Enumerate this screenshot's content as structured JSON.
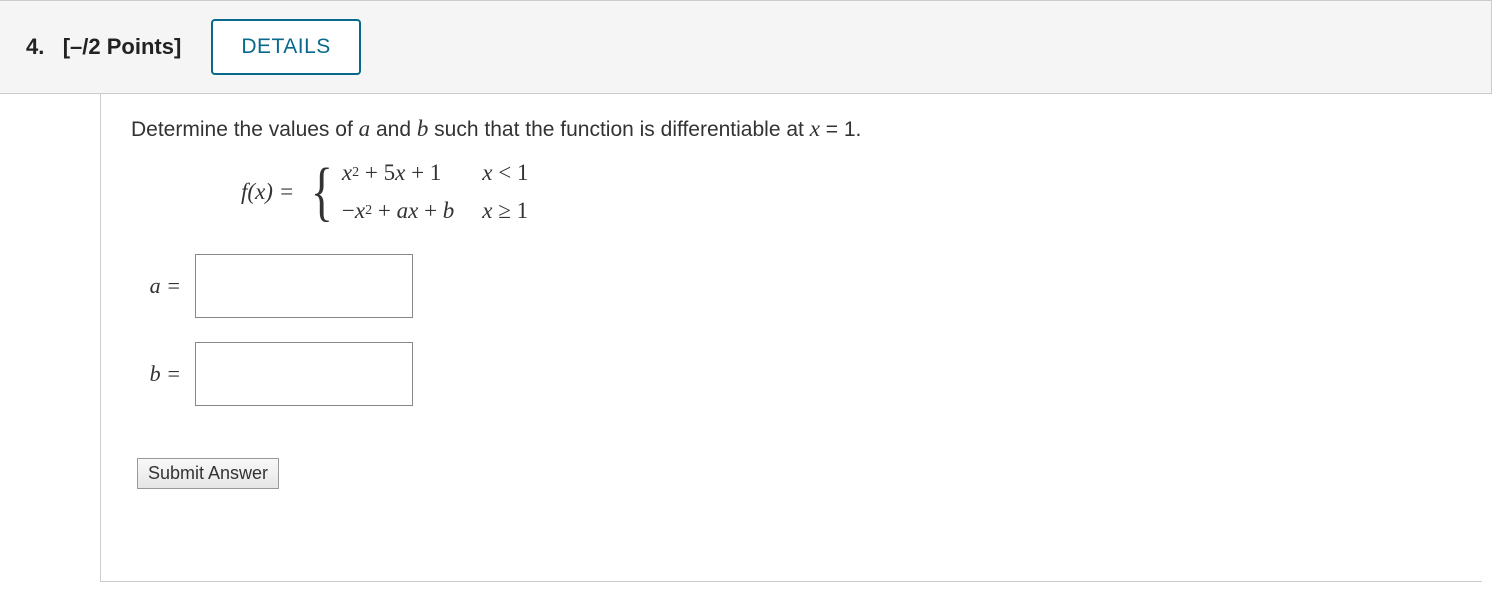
{
  "header": {
    "number": "4.",
    "points": "[–/2 Points]",
    "details_label": "DETAILS"
  },
  "prompt": {
    "pre": "Determine the values of ",
    "a": "a",
    "mid1": " and ",
    "b": "b",
    "mid2": " such that the function is differentiable at  ",
    "xvar": "x",
    "eq": " = 1."
  },
  "function": {
    "lhs": "f(x) =",
    "piece1": "x² + 5x + 1",
    "piece2": "−x² + ax + b",
    "cond1": "x < 1",
    "cond2": "x ≥ 1"
  },
  "answers": {
    "a_label": "a =",
    "b_label": "b =",
    "a_value": "",
    "b_value": ""
  },
  "submit_label": "Submit Answer"
}
